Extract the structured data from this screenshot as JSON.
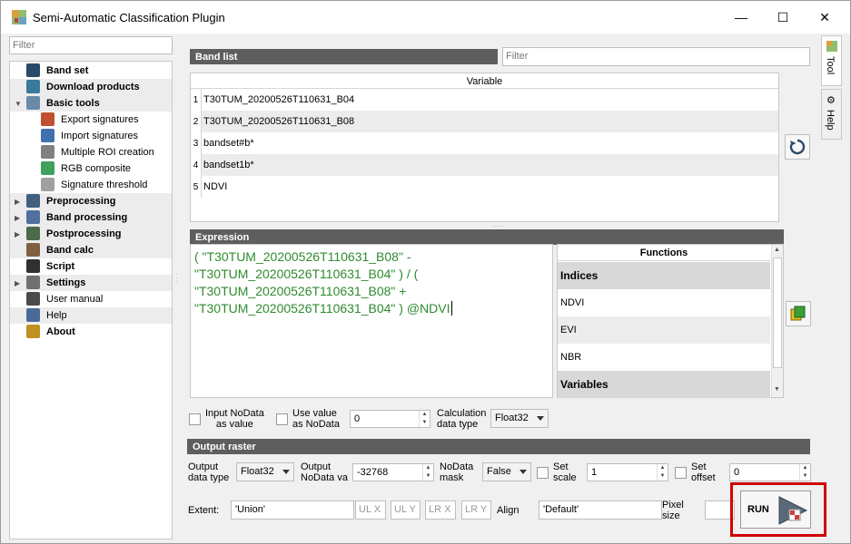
{
  "window": {
    "title": "Semi-Automatic Classification Plugin",
    "min": "—",
    "max": "☐",
    "close": "✕"
  },
  "filter_placeholder": "Filter",
  "tree": [
    {
      "label": "Band set",
      "bold": true,
      "icon": "band-set-icon"
    },
    {
      "label": "Download products",
      "bold": true,
      "icon": "download-icon"
    },
    {
      "label": "Basic tools",
      "bold": true,
      "icon": "basic-tools-icon",
      "expanded": true
    },
    {
      "label": "Export signatures",
      "bold": false,
      "icon": "export-signatures-icon"
    },
    {
      "label": "Import signatures",
      "bold": false,
      "icon": "import-signatures-icon"
    },
    {
      "label": "Multiple ROI creation",
      "bold": false,
      "icon": "multiple-roi-icon"
    },
    {
      "label": "RGB composite",
      "bold": false,
      "icon": "rgb-composite-icon"
    },
    {
      "label": "Signature threshold",
      "bold": false,
      "icon": "signature-threshold-icon"
    },
    {
      "label": "Preprocessing",
      "bold": true,
      "icon": "preprocessing-icon",
      "collapsed": true
    },
    {
      "label": "Band processing",
      "bold": true,
      "icon": "band-processing-icon",
      "collapsed": true
    },
    {
      "label": "Postprocessing",
      "bold": true,
      "icon": "postprocessing-icon",
      "collapsed": true
    },
    {
      "label": "Band calc",
      "bold": true,
      "icon": "band-calc-icon"
    },
    {
      "label": "Script",
      "bold": true,
      "icon": "script-icon"
    },
    {
      "label": "Settings",
      "bold": true,
      "icon": "settings-icon",
      "collapsed": true
    },
    {
      "label": "User manual",
      "bold": false,
      "icon": "user-manual-icon"
    },
    {
      "label": "Help",
      "bold": false,
      "icon": "help-icon"
    },
    {
      "label": "About",
      "bold": true,
      "icon": "about-icon"
    }
  ],
  "band_list": {
    "header": "Band list",
    "filter_placeholder": "Filter",
    "column": "Variable",
    "rows": [
      {
        "n": "1",
        "v": "T30TUM_20200526T110631_B04"
      },
      {
        "n": "2",
        "v": "T30TUM_20200526T110631_B08"
      },
      {
        "n": "3",
        "v": "bandset#b*"
      },
      {
        "n": "4",
        "v": "bandset1b*"
      },
      {
        "n": "5",
        "v": "NDVI"
      }
    ]
  },
  "expression": {
    "header": "Expression",
    "lines": [
      "( \"T30TUM_20200526T110631_B08\" -",
      "\"T30TUM_20200526T110631_B04\" ) / (",
      "\"T30TUM_20200526T110631_B08\" +",
      "\"T30TUM_20200526T110631_B04\" ) @NDVI"
    ]
  },
  "functions": {
    "header": "Functions",
    "items": [
      {
        "label": "Indices",
        "bold": true
      },
      {
        "label": "NDVI",
        "bold": false
      },
      {
        "label": "EVI",
        "bold": false
      },
      {
        "label": "NBR",
        "bold": false
      },
      {
        "label": "Variables",
        "bold": true
      }
    ]
  },
  "options": {
    "input_nodata": "Input NoData\nas value",
    "use_value": "Use value\nas NoData",
    "use_value_val": "0",
    "calc_dtype_label": "Calculation\ndata type",
    "calc_dtype": "Float32"
  },
  "output": {
    "header": "Output raster",
    "dtype_label": "Output\ndata type",
    "dtype": "Float32",
    "nodata_label": "Output\nNoData va",
    "nodata_val": "-32768",
    "mask_label": "NoData\nmask",
    "mask": "False",
    "scale_label": "Set\nscale",
    "scale_val": "1",
    "offset_label": "Set\noffset",
    "offset_val": "0"
  },
  "extent": {
    "label": "Extent:",
    "value": "'Union'",
    "ulx": "UL X",
    "uly": "UL Y",
    "lrx": "LR X",
    "lry": "LR Y",
    "align_label": "Align",
    "align_value": "'Default'",
    "pixel_label": "Pixel\nsize"
  },
  "run_label": "RUN",
  "side_tabs": {
    "tool": "Tool",
    "help": "Help"
  },
  "colors": {
    "green_text": "#2e8b2e",
    "header_bg": "#5e5e5e",
    "highlight": "#d00000"
  }
}
